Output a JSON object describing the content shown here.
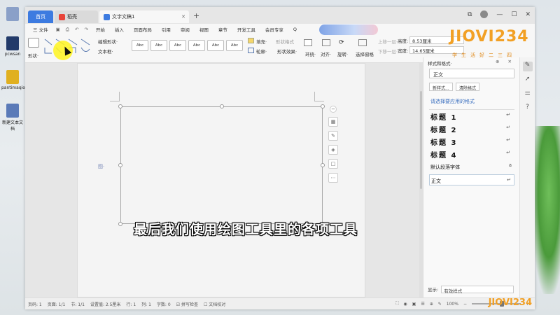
{
  "desktop": {
    "icons": [
      {
        "label": "",
        "color": "#8aa0c8"
      },
      {
        "label": "pcwsan",
        "color": "#223a6a"
      },
      {
        "label": "pantimaqiol",
        "color": "#e0b020"
      },
      {
        "label": "新建文本文档",
        "color": "#5a7ab8"
      }
    ]
  },
  "tabs": {
    "home": "首页",
    "daoke": "稻壳",
    "doc": "文字文稿1",
    "new_tab": "+"
  },
  "menu": {
    "file": "三 文件",
    "items": [
      "开始",
      "插入",
      "页面布局",
      "引用",
      "审阅",
      "视图",
      "章节",
      "开发工具",
      "会员专享"
    ],
    "find": "Q"
  },
  "ribbon": {
    "shape_label": "形状·",
    "edit_shape": "编辑形状·",
    "text_box": "文本框·",
    "style_samples": [
      "Abc",
      "Abc",
      "Abc",
      "Abc",
      "Abc",
      "Abc"
    ],
    "fill": "填充·",
    "outline": "轮廓·",
    "shape_effect": "形状效果·",
    "shape_format": "形状格式",
    "wrap": "环绕·",
    "align": "对齐·",
    "rotate": "旋转·",
    "select_pane": "选择窗格",
    "up_layer": "上移一层·",
    "down_layer": "下移一层·",
    "height_label": "高度:",
    "height_value": "8.53厘米",
    "width_label": "宽度:",
    "width_value": "14.65厘米",
    "logo": "JIOVI234",
    "logo_sub": "学生活好二三四"
  },
  "canvas": {
    "anchor": "图·"
  },
  "subtitle": "最后我们使用绘图工具里的各项工具",
  "style_pane": {
    "title": "样式和格式·",
    "current_style": "正文",
    "new_style": "新样式...",
    "clear_format": "清除格式",
    "apply_prompt": "请选择要应用的格式",
    "styles": [
      {
        "name": "标题 1",
        "mark": "↵"
      },
      {
        "name": "标题 2",
        "mark": "↵"
      },
      {
        "name": "标题 3",
        "mark": "↵"
      },
      {
        "name": "标题 4",
        "mark": "↵"
      },
      {
        "name": "默认段落字体",
        "mark": "a"
      },
      {
        "name": "正文",
        "mark": "↵"
      }
    ],
    "show_label": "显示:",
    "show_value": "有效样式"
  },
  "statusbar": {
    "page_num": "页码: 1",
    "pages": "页面: 1/1",
    "section": "节: 1/1",
    "setting": "设置值: 2.5厘米",
    "row": "行: 1",
    "col": "列: 1",
    "words": "字数: 0",
    "spell": "拼写检查",
    "doc_check": "文档校对",
    "zoom": "100%",
    "zoom_level": 0.62,
    "watermark": "JIOVI234"
  }
}
